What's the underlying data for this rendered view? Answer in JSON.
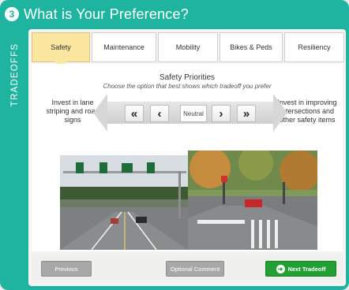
{
  "header": {
    "step": "3",
    "title": "What is Your Preference?",
    "side_label": "TRADEOFFS"
  },
  "tabs": [
    {
      "label": "Safety",
      "active": true
    },
    {
      "label": "Maintenance",
      "active": false
    },
    {
      "label": "Mobility",
      "active": false
    },
    {
      "label": "Bikes & Peds",
      "active": false
    },
    {
      "label": "Resiliency",
      "active": false
    }
  ],
  "priority": {
    "title": "Safety Priorities",
    "subtitle": "Choose the option that best shows which tradeoff you prefer",
    "left_option": "Invest in lane striping and road signs",
    "right_option": "Invest in improving intersections and other safety items",
    "neutral_label": "Neutral",
    "buttons": {
      "far_left": "«",
      "left": "‹",
      "right": "›",
      "far_right": "»"
    }
  },
  "photos": {
    "left": "lane-striping-road-signs-photo",
    "right": "intersection-improvement-photo"
  },
  "footer": {
    "previous": "Previous",
    "optional_comment": "Optional Comment",
    "next": "Next Tradeoff"
  },
  "colors": {
    "frame": "#1fb4a0",
    "active_tab": "#fbe6a0",
    "next_button": "#22a033",
    "grey_button": "#a8a8a8"
  }
}
